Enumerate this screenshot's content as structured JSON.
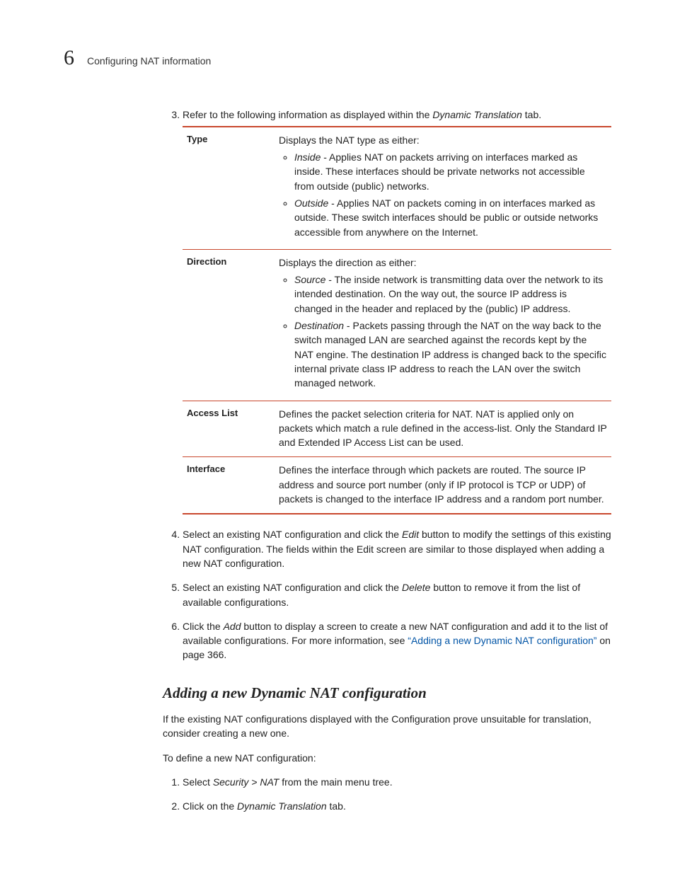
{
  "header": {
    "chapter_number": "6",
    "chapter_sub": "Configuring NAT information"
  },
  "step3": {
    "num": "3.",
    "text_pre": "Refer to the following information as displayed within the ",
    "text_italic": "Dynamic Translation",
    "text_post": " tab."
  },
  "table": {
    "rows": [
      {
        "term": "Type",
        "intro": "Displays the NAT type as either:",
        "bullets": [
          {
            "lead": "Inside",
            "rest": " - Applies NAT on packets arriving on interfaces marked as inside. These interfaces should be private networks not accessible from outside (public) networks."
          },
          {
            "lead": "Outside",
            "rest": " - Applies NAT on packets coming in on interfaces marked as outside. These switch interfaces should be public or outside networks accessible from anywhere on the Internet."
          }
        ]
      },
      {
        "term": "Direction",
        "intro": "Displays the direction as either:",
        "bullets": [
          {
            "lead": "Source",
            "rest": " - The inside network is transmitting data over the network to its intended destination. On the way out, the source IP address is changed in the header and replaced by the (public) IP address."
          },
          {
            "lead": "Destination",
            "rest": " - Packets passing through the NAT on the way back to the switch managed LAN are searched against the records kept by the NAT engine. The destination IP address is changed back to the specific internal private class IP address to reach the LAN over the switch managed network."
          }
        ]
      },
      {
        "term": "Access List",
        "plain": "Defines the packet selection criteria for NAT. NAT is applied only on packets which match a rule defined in the access-list. Only the Standard IP and Extended IP Access List can be used."
      },
      {
        "term": "Interface",
        "plain": "Defines the interface through which packets are routed. The source IP address and source port number (only if IP protocol is TCP or UDP) of packets is changed to the interface IP address and a random port number."
      }
    ]
  },
  "step4": {
    "pre": "Select an existing NAT configuration and click the ",
    "it1": "Edit",
    "post": " button to modify the settings of this existing NAT configuration. The fields within the Edit screen are similar to those displayed when adding a new NAT configuration."
  },
  "step5": {
    "pre": "Select an existing NAT configuration and click the ",
    "it1": "Delete",
    "post": " button to remove it from the list of available configurations."
  },
  "step6": {
    "pre": "Click the ",
    "it1": "Add",
    "mid": " button to display a screen to create a new NAT configuration and add it to the list of available configurations. For more information, see ",
    "link": "“Adding a new Dynamic NAT configuration”",
    "post": " on page 366."
  },
  "section": {
    "heading": "Adding a new Dynamic NAT configuration",
    "intro": "If the existing NAT configurations displayed with the Configuration prove unsuitable for translation, consider creating a new one.",
    "lead": "To define a new NAT configuration:",
    "s1_pre": "Select ",
    "s1_it": "Security > NAT",
    "s1_post": " from the main menu tree.",
    "s2_pre": "Click on the ",
    "s2_it": "Dynamic Translation",
    "s2_post": " tab."
  }
}
